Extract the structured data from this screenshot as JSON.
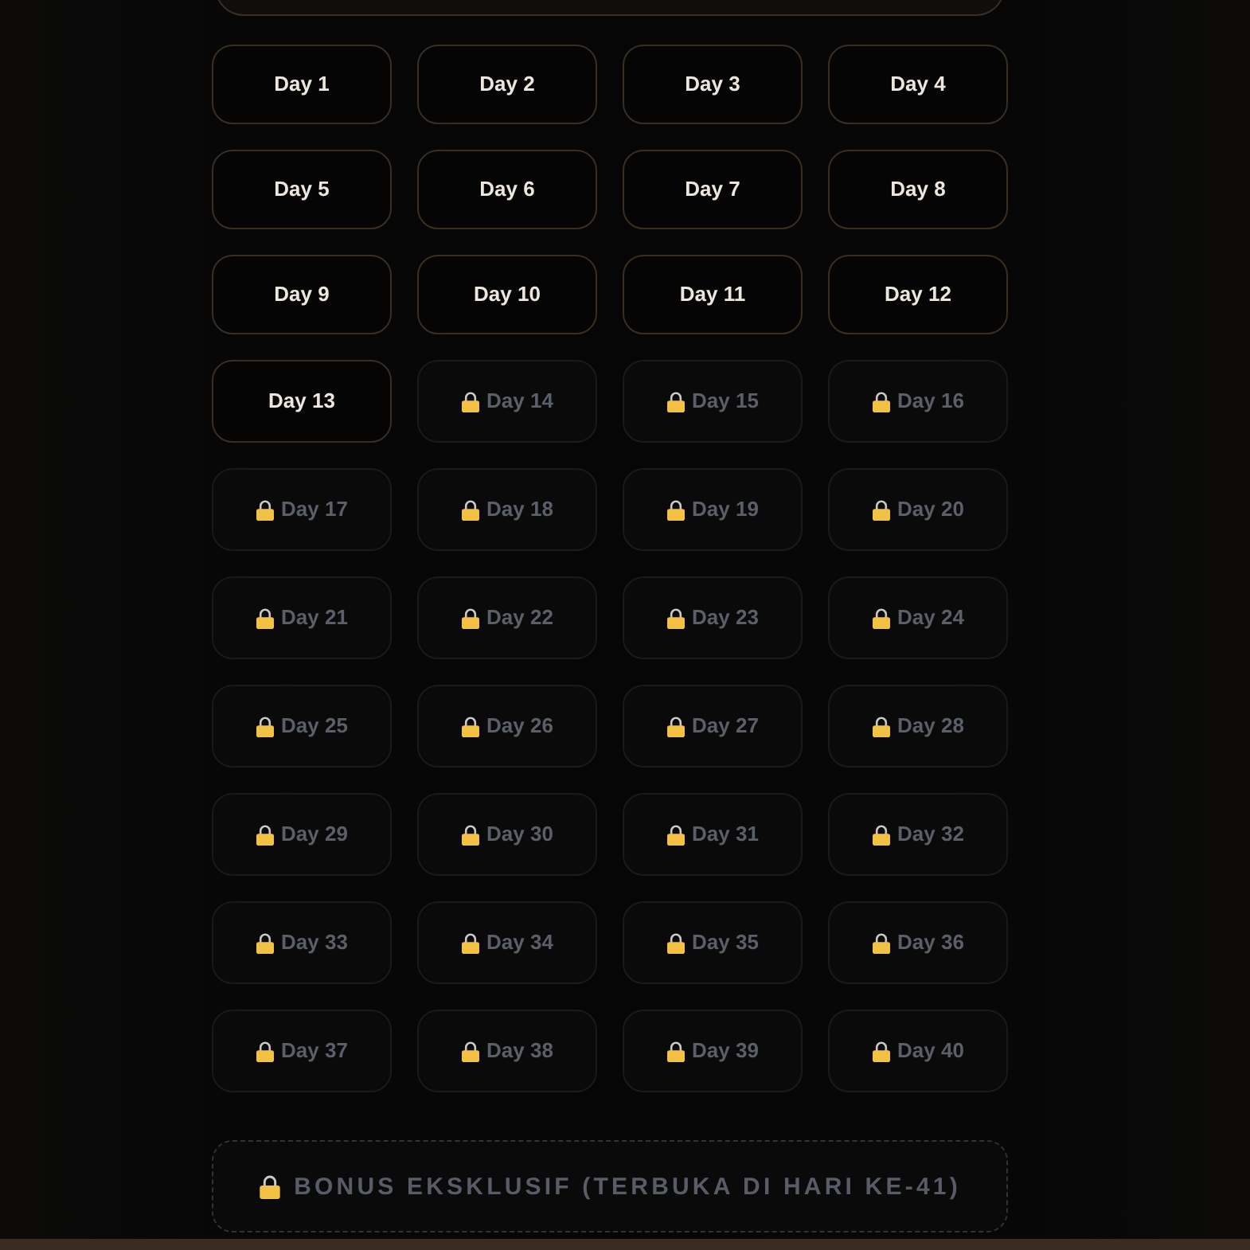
{
  "days": [
    {
      "label": "Day 1",
      "locked": false
    },
    {
      "label": "Day 2",
      "locked": false
    },
    {
      "label": "Day 3",
      "locked": false
    },
    {
      "label": "Day 4",
      "locked": false
    },
    {
      "label": "Day 5",
      "locked": false
    },
    {
      "label": "Day 6",
      "locked": false
    },
    {
      "label": "Day 7",
      "locked": false
    },
    {
      "label": "Day 8",
      "locked": false
    },
    {
      "label": "Day 9",
      "locked": false
    },
    {
      "label": "Day 10",
      "locked": false
    },
    {
      "label": "Day 11",
      "locked": false
    },
    {
      "label": "Day 12",
      "locked": false
    },
    {
      "label": "Day 13",
      "locked": false
    },
    {
      "label": "Day 14",
      "locked": true
    },
    {
      "label": "Day 15",
      "locked": true
    },
    {
      "label": "Day 16",
      "locked": true
    },
    {
      "label": "Day 17",
      "locked": true
    },
    {
      "label": "Day 18",
      "locked": true
    },
    {
      "label": "Day 19",
      "locked": true
    },
    {
      "label": "Day 20",
      "locked": true
    },
    {
      "label": "Day 21",
      "locked": true
    },
    {
      "label": "Day 22",
      "locked": true
    },
    {
      "label": "Day 23",
      "locked": true
    },
    {
      "label": "Day 24",
      "locked": true
    },
    {
      "label": "Day 25",
      "locked": true
    },
    {
      "label": "Day 26",
      "locked": true
    },
    {
      "label": "Day 27",
      "locked": true
    },
    {
      "label": "Day 28",
      "locked": true
    },
    {
      "label": "Day 29",
      "locked": true
    },
    {
      "label": "Day 30",
      "locked": true
    },
    {
      "label": "Day 31",
      "locked": true
    },
    {
      "label": "Day 32",
      "locked": true
    },
    {
      "label": "Day 33",
      "locked": true
    },
    {
      "label": "Day 34",
      "locked": true
    },
    {
      "label": "Day 35",
      "locked": true
    },
    {
      "label": "Day 36",
      "locked": true
    },
    {
      "label": "Day 37",
      "locked": true
    },
    {
      "label": "Day 38",
      "locked": true
    },
    {
      "label": "Day 39",
      "locked": true
    },
    {
      "label": "Day 40",
      "locked": true
    }
  ],
  "bonus": {
    "label": "BONUS EKSKLUSIF (TERBUKA DI HARI KE-41)",
    "locked": true
  }
}
